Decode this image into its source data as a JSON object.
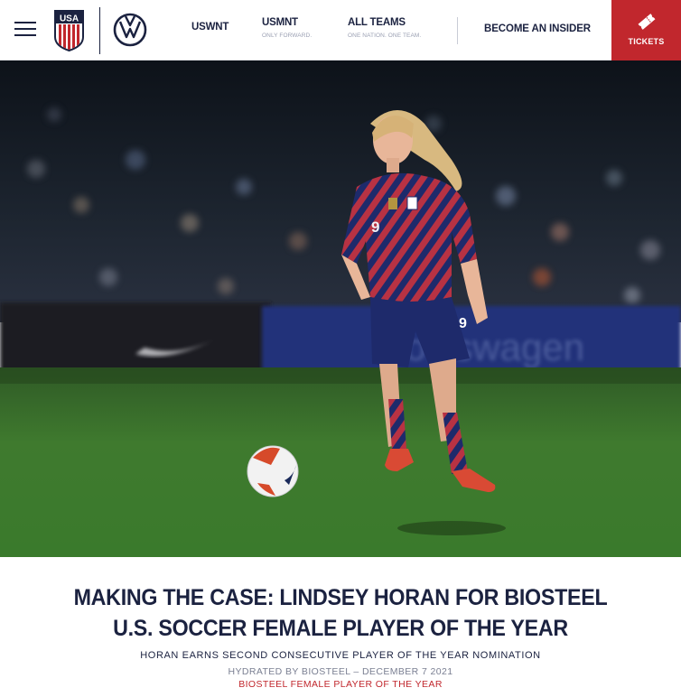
{
  "header": {
    "nav": [
      {
        "label": "USWNT",
        "sub": ""
      },
      {
        "label": "USMNT",
        "sub": "ONLY FORWARD."
      },
      {
        "label": "ALL TEAMS",
        "sub": "ONE NATION. ONE TEAM."
      }
    ],
    "insider_label": "BECOME AN INSIDER",
    "tickets_label": "TICKETS"
  },
  "hero": {
    "jersey_number": "9",
    "board_text": "Volkswagen"
  },
  "article": {
    "headline": "MAKING THE CASE: LINDSEY HORAN FOR BIOSTEEL U.S. SOCCER FEMALE PLAYER OF THE YEAR",
    "subhead": "HORAN EARNS SECOND CONSECUTIVE PLAYER OF THE YEAR NOMINATION",
    "meta": "HYDRATED BY BIOSTEEL – DECEMBER 7 2021",
    "category": "BIOSTEEL FEMALE PLAYER OF THE YEAR"
  },
  "colors": {
    "navy": "#1b2240",
    "red": "#c1272d",
    "pitch": "#3f7a2e"
  }
}
